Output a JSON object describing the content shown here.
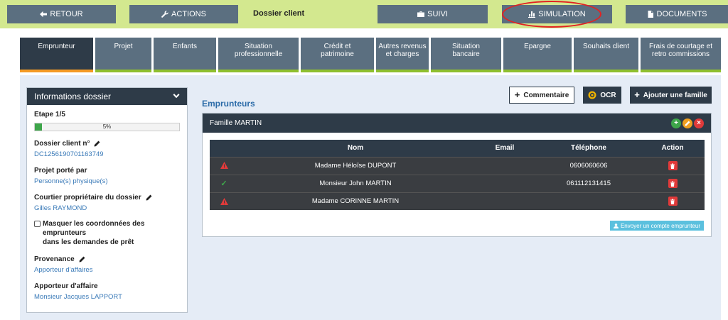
{
  "topbar": {
    "back_label": "RETOUR",
    "actions_label": "ACTIONS",
    "title": "Dossier client",
    "suivi_label": "SUIVI",
    "simulation_label": "SIMULATION",
    "documents_label": "DOCUMENTS"
  },
  "tabs": [
    {
      "line1": "Emprunteur",
      "line2": ""
    },
    {
      "line1": "Projet",
      "line2": ""
    },
    {
      "line1": "Enfants",
      "line2": ""
    },
    {
      "line1": "Situation",
      "line2": "professionnelle"
    },
    {
      "line1": "Crédit et",
      "line2": "patrimoine"
    },
    {
      "line1": "Autres revenus",
      "line2": "et charges"
    },
    {
      "line1": "Situation",
      "line2": "bancaire"
    },
    {
      "line1": "Epargne",
      "line2": ""
    },
    {
      "line1": "Souhaits client",
      "line2": ""
    },
    {
      "line1": "Frais de courtage et",
      "line2": "retro commissions"
    }
  ],
  "info": {
    "header": "Informations dossier",
    "step_label": "Etape 1/5",
    "progress": 5,
    "progress_text": "5%",
    "dossier_label": "Dossier client n°",
    "dossier_value": "DC1256190701163749",
    "projet_label": "Projet porté par",
    "projet_value": "Personne(s) physique(s)",
    "courtier_label": "Courtier propriétaire du dossier",
    "courtier_value": "Gilles RAYMOND",
    "masquer_line1": "Masquer les coordonnées des emprunteurs",
    "masquer_line2": "dans les demandes de prêt",
    "provenance_label": "Provenance",
    "provenance_value": "Apporteur d'affaires",
    "apporteur_label": "Apporteur d'affaire",
    "apporteur_value": "Monsieur Jacques LAPPORT"
  },
  "main": {
    "section_title": "Emprunteurs",
    "comment_label": "Commentaire",
    "ocr_label": "OCR",
    "add_family_label": "Ajouter une famille",
    "family_title": "Famille MARTIN",
    "send_account_label": "Envoyer un compte emprunteur",
    "columns": {
      "name": "Nom",
      "email": "Email",
      "phone": "Téléphone",
      "action": "Action"
    },
    "rows": [
      {
        "status": "warning",
        "name": "Madame Héloïse DUPONT",
        "email": "",
        "phone": "0606060606"
      },
      {
        "status": "ok",
        "name": "Monsieur John MARTIN",
        "email": "",
        "phone": "061112131415"
      },
      {
        "status": "warning",
        "name": "Madame CORINNE MARTIN",
        "email": "",
        "phone": ""
      }
    ]
  },
  "colors": {
    "topbar_bg": "#d3e88f",
    "button_bg": "#5b6f80",
    "dark": "#2e3b48",
    "accent_orange": "#f49a24",
    "accent_green": "#8fbf2f",
    "link_blue": "#3a7ab8",
    "danger": "#e03a3a",
    "highlight_red": "#e32222"
  }
}
